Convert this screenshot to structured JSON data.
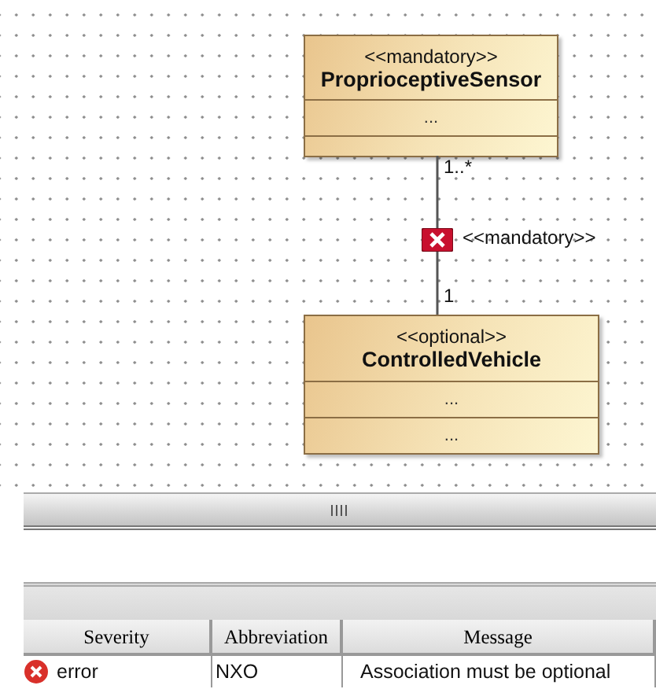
{
  "diagram": {
    "classes": [
      {
        "stereotype": "<<mandatory>>",
        "name": "ProprioceptiveSensor",
        "compartments": [
          {
            "kind": "attributes",
            "text": "..."
          },
          {
            "kind": "operations"
          }
        ]
      },
      {
        "stereotype": "<<optional>>",
        "name": "ControlledVehicle",
        "compartments": [
          {
            "kind": "attributes",
            "text": "..."
          },
          {
            "kind": "operations",
            "text": "..."
          }
        ]
      }
    ],
    "association": {
      "source_multiplicity": "1..*",
      "target_multiplicity": "1",
      "stereotype": "<<mandatory>>",
      "error": true
    }
  },
  "problems": {
    "columns": [
      "Severity",
      "Abbreviation",
      "Message"
    ],
    "rows": [
      {
        "severity": "error",
        "abbreviation": "NXO",
        "message": "Association must be optional"
      }
    ]
  }
}
